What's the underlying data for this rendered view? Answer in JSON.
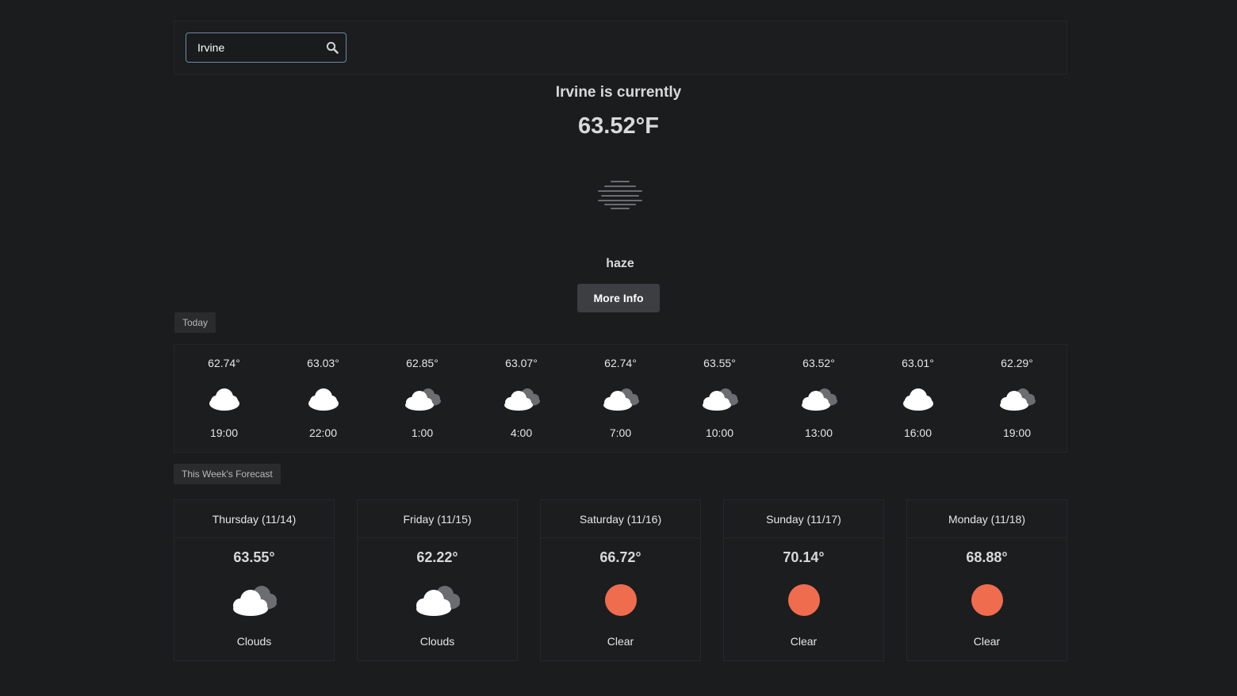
{
  "search": {
    "value": "Irvine"
  },
  "current": {
    "title": "Irvine is currently",
    "temperature": "63.52°F",
    "description": "haze",
    "icon": "haze-icon",
    "more_info_label": "More Info"
  },
  "sections": {
    "today_label": "Today",
    "week_label": "This Week's Forecast"
  },
  "hourly": [
    {
      "temp": "62.74°",
      "time": "19:00",
      "icon": "cloud-icon"
    },
    {
      "temp": "63.03°",
      "time": "22:00",
      "icon": "cloud-icon"
    },
    {
      "temp": "62.85°",
      "time": "1:00",
      "icon": "clouds-icon"
    },
    {
      "temp": "63.07°",
      "time": "4:00",
      "icon": "clouds-icon"
    },
    {
      "temp": "62.74°",
      "time": "7:00",
      "icon": "clouds-icon"
    },
    {
      "temp": "63.55°",
      "time": "10:00",
      "icon": "clouds-icon"
    },
    {
      "temp": "63.52°",
      "time": "13:00",
      "icon": "clouds-icon"
    },
    {
      "temp": "63.01°",
      "time": "16:00",
      "icon": "cloud-icon"
    },
    {
      "temp": "62.29°",
      "time": "19:00",
      "icon": "clouds-icon"
    }
  ],
  "week": [
    {
      "day": "Thursday (11/14)",
      "temp": "63.55°",
      "desc": "Clouds",
      "icon": "clouds-icon"
    },
    {
      "day": "Friday (11/15)",
      "temp": "62.22°",
      "desc": "Clouds",
      "icon": "clouds-icon"
    },
    {
      "day": "Saturday (11/16)",
      "temp": "66.72°",
      "desc": "Clear",
      "icon": "sun-icon"
    },
    {
      "day": "Sunday (11/17)",
      "temp": "70.14°",
      "desc": "Clear",
      "icon": "sun-icon"
    },
    {
      "day": "Monday (11/18)",
      "temp": "68.88°",
      "desc": "Clear",
      "icon": "sun-icon"
    }
  ],
  "colors": {
    "background": "#1b1c1e",
    "panel": "#1c1d1f",
    "button": "#3c3e41",
    "sun": "#ef6c4f",
    "cloud": "#ffffff",
    "cloud_back": "#6b6d70",
    "search_border": "#6f89a8"
  }
}
